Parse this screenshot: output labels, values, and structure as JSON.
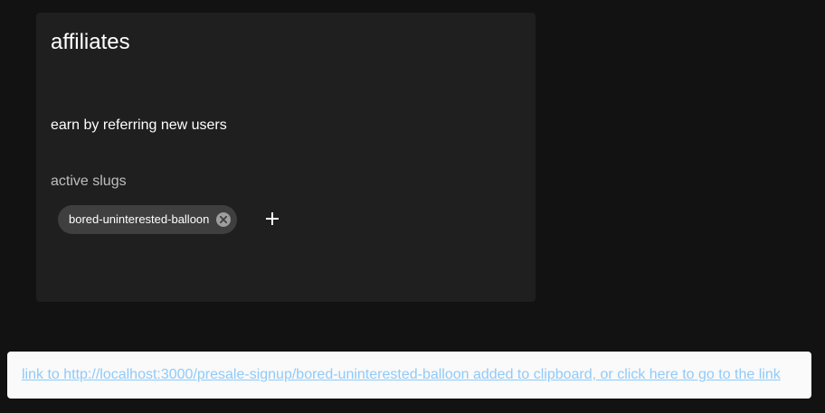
{
  "affiliates": {
    "title": "affiliates",
    "description": "earn by referring new users",
    "active_slugs_label": "active slugs",
    "slugs": [
      {
        "label": "bored-uninterested-balloon",
        "delete_icon": "cancel-circle-icon"
      }
    ],
    "add_icon": "plus-icon"
  },
  "snackbar": {
    "message": "link to http://localhost:3000/presale-signup/bored-uninterested-balloon added to clipboard, or click here to go to the link"
  },
  "colors": {
    "page_background": "#121212",
    "card_background": "#1f1f1f",
    "chip_background": "#3f3f3f",
    "snackbar_background": "#fafafa",
    "link": "#90caf9"
  }
}
